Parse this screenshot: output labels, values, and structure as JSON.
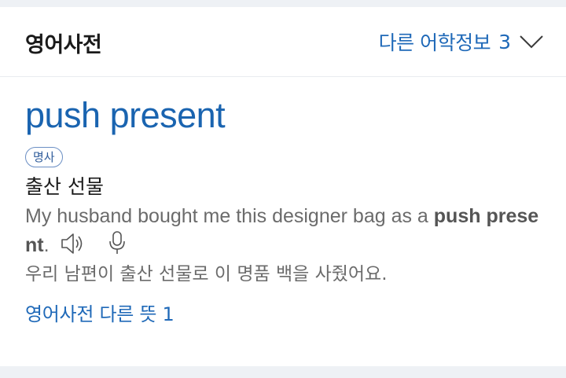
{
  "header": {
    "title": "영어사전",
    "more_info_label": "다른 어학정보",
    "more_info_count": "3"
  },
  "entry": {
    "word": "push present",
    "part_of_speech": "명사",
    "meaning": "출산 선물",
    "example": {
      "before": "My husband bought me this designer bag as a ",
      "highlight": "push present",
      "after": "."
    },
    "translation": "우리 남편이 출산 선물로 이 명품 백을 사줬어요.",
    "other_meanings_label": "영어사전 다른 뜻",
    "other_meanings_count": "1"
  },
  "icons": {
    "chevron": "chevron-down-icon",
    "speaker": "speaker-icon",
    "mic": "microphone-icon"
  },
  "colors": {
    "link_blue": "#1f69b8",
    "background": "#eef1f5"
  }
}
